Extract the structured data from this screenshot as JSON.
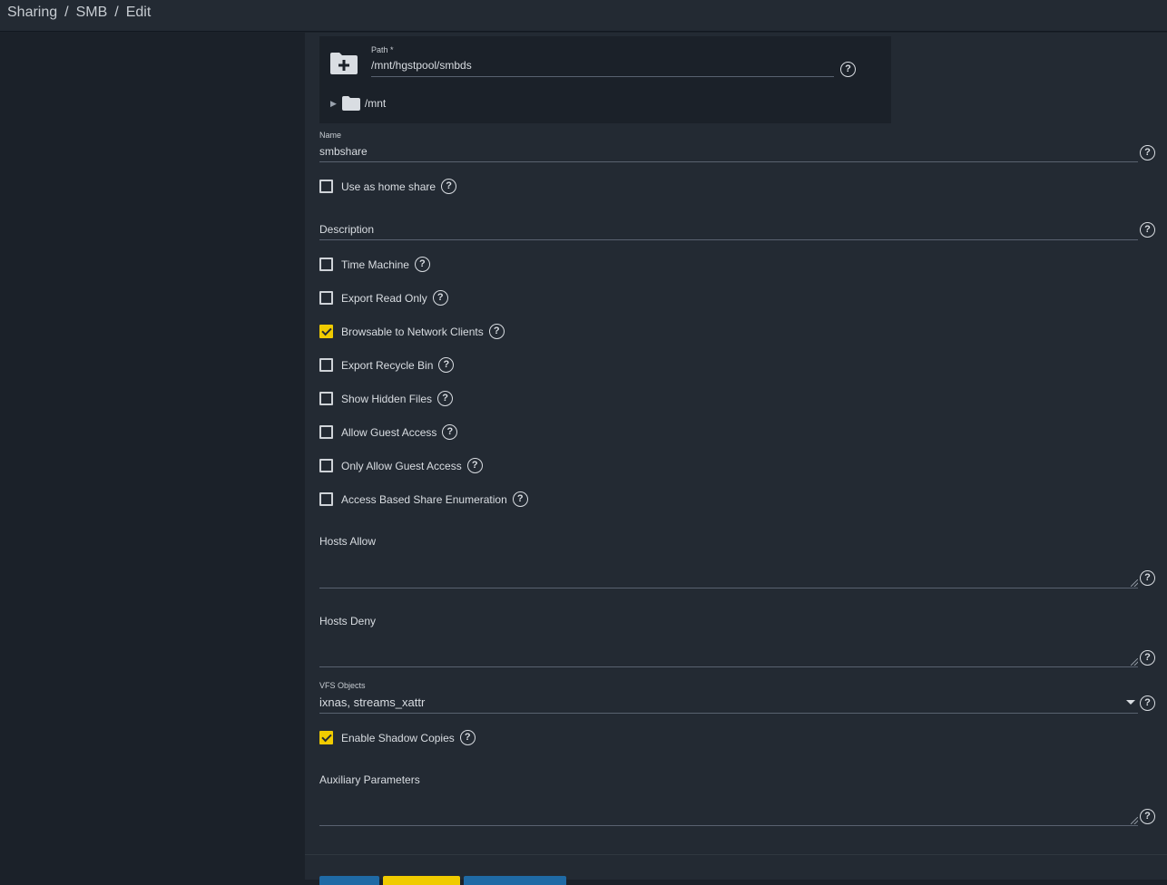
{
  "breadcrumb": {
    "items": [
      "Sharing",
      "SMB",
      "Edit"
    ],
    "separator": "/"
  },
  "path": {
    "label": "Path *",
    "value": "/mnt/hgstpool/smbds",
    "tree_root": "/mnt"
  },
  "name_field": {
    "label": "Name",
    "value": "smbshare"
  },
  "use_home_share": {
    "label": "Use as home share",
    "checked": false
  },
  "description_field": {
    "label": "Description",
    "value": ""
  },
  "checkboxes": [
    {
      "label": "Time Machine",
      "checked": false
    },
    {
      "label": "Export Read Only",
      "checked": false
    },
    {
      "label": "Browsable to Network Clients",
      "checked": true
    },
    {
      "label": "Export Recycle Bin",
      "checked": false
    },
    {
      "label": "Show Hidden Files",
      "checked": false
    },
    {
      "label": "Allow Guest Access",
      "checked": false
    },
    {
      "label": "Only Allow Guest Access",
      "checked": false
    },
    {
      "label": "Access Based Share Enumeration",
      "checked": false
    }
  ],
  "hosts_allow": {
    "label": "Hosts Allow",
    "value": ""
  },
  "hosts_deny": {
    "label": "Hosts Deny",
    "value": ""
  },
  "vfs_objects": {
    "label": "VFS Objects",
    "value": "ixnas, streams_xattr"
  },
  "shadow_copies": {
    "label": "Enable Shadow Copies",
    "checked": true
  },
  "aux_params": {
    "label": "Auxiliary Parameters",
    "value": ""
  },
  "help_glyph": "?",
  "colors": {
    "accent": "#f0cb00",
    "primary_button": "#1f6aa5",
    "form_bg": "#232a33",
    "sidebar_bg": "#1b2129"
  }
}
